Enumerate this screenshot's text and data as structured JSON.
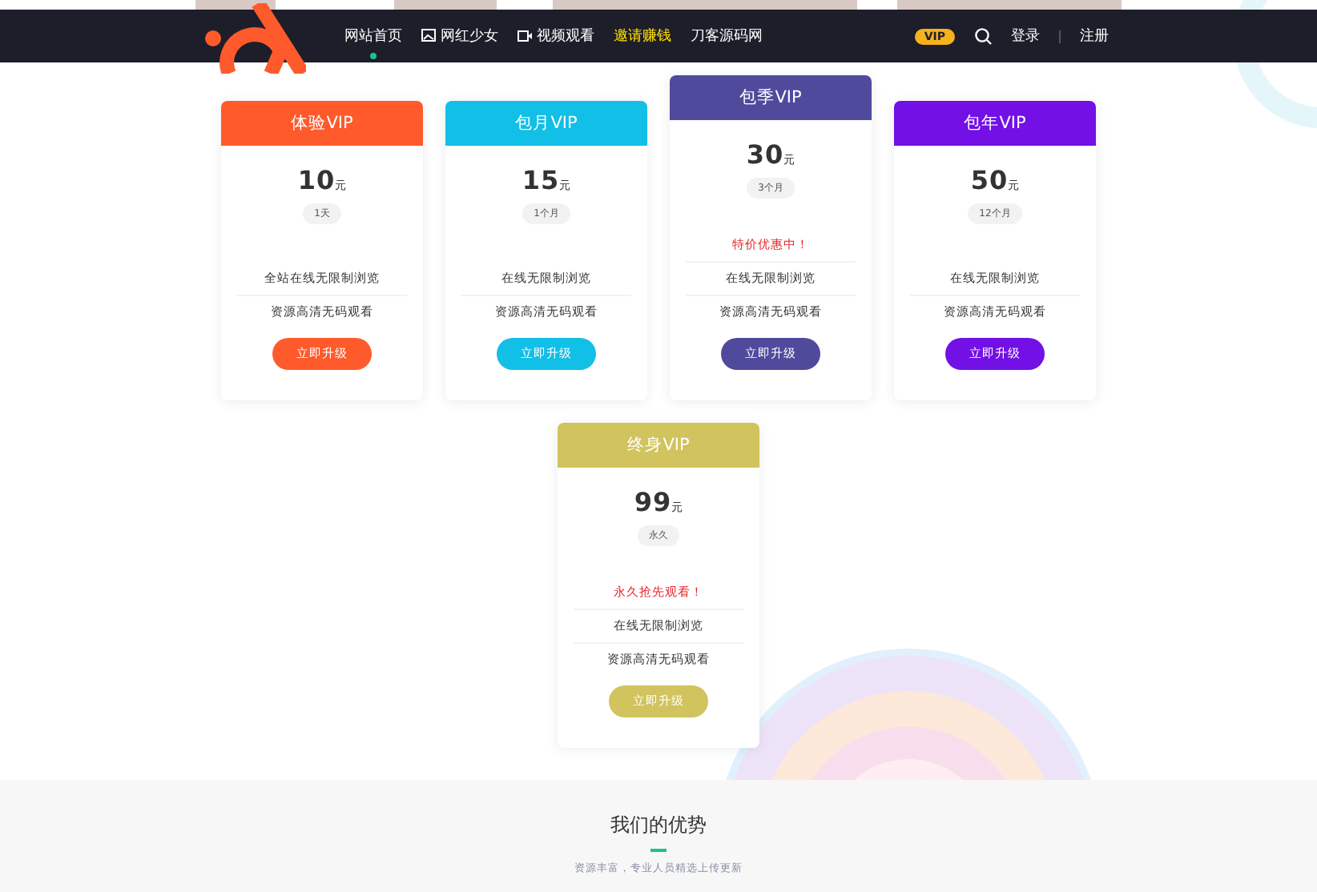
{
  "header": {
    "nav": [
      {
        "label": "网站首页",
        "selected": true,
        "highlighted": false
      },
      {
        "label": "网红少女",
        "kind": "image",
        "selected": false,
        "highlighted": false
      },
      {
        "label": "视频观看",
        "kind": "video",
        "selected": false,
        "highlighted": false
      },
      {
        "label": "邀请赚钱",
        "selected": false,
        "highlighted": true
      },
      {
        "label": "刀客源码网",
        "selected": false,
        "highlighted": false
      }
    ],
    "vip_badge": "VIP",
    "login": "登录",
    "register": "注册"
  },
  "plans": [
    {
      "name": "体验VIP",
      "color": "#ff5a2c",
      "price": "10",
      "unit": "元",
      "duration": "1天",
      "features": [
        "全站在线无限制浏览",
        "资源高清无码观看"
      ],
      "button": "立即升级"
    },
    {
      "name": "包月VIP",
      "color": "#12bfe6",
      "price": "15",
      "unit": "元",
      "duration": "1个月",
      "features": [
        "在线无限制浏览",
        "资源高清无码观看"
      ],
      "button": "立即升级"
    },
    {
      "name": "包季VIP",
      "color": "#504a9d",
      "price": "30",
      "unit": "元",
      "duration": "3个月",
      "promo": "特价优惠中！",
      "features": [
        "在线无限制浏览",
        "资源高清无码观看"
      ],
      "button": "立即升级"
    },
    {
      "name": "包年VIP",
      "color": "#7210e6",
      "price": "50",
      "unit": "元",
      "duration": "12个月",
      "features": [
        "在线无限制浏览",
        "资源高清无码观看"
      ],
      "button": "立即升级"
    },
    {
      "name": "终身VIP",
      "color": "#d1c35d",
      "price": "99",
      "unit": "元",
      "duration": "永久",
      "promo": "永久抢先观看！",
      "features": [
        "在线无限制浏览",
        "资源高清无码观看"
      ],
      "button": "立即升级"
    }
  ],
  "advantages": {
    "title": "我们的优势",
    "subtitle": "资源丰富，专业人员精选上传更新"
  }
}
